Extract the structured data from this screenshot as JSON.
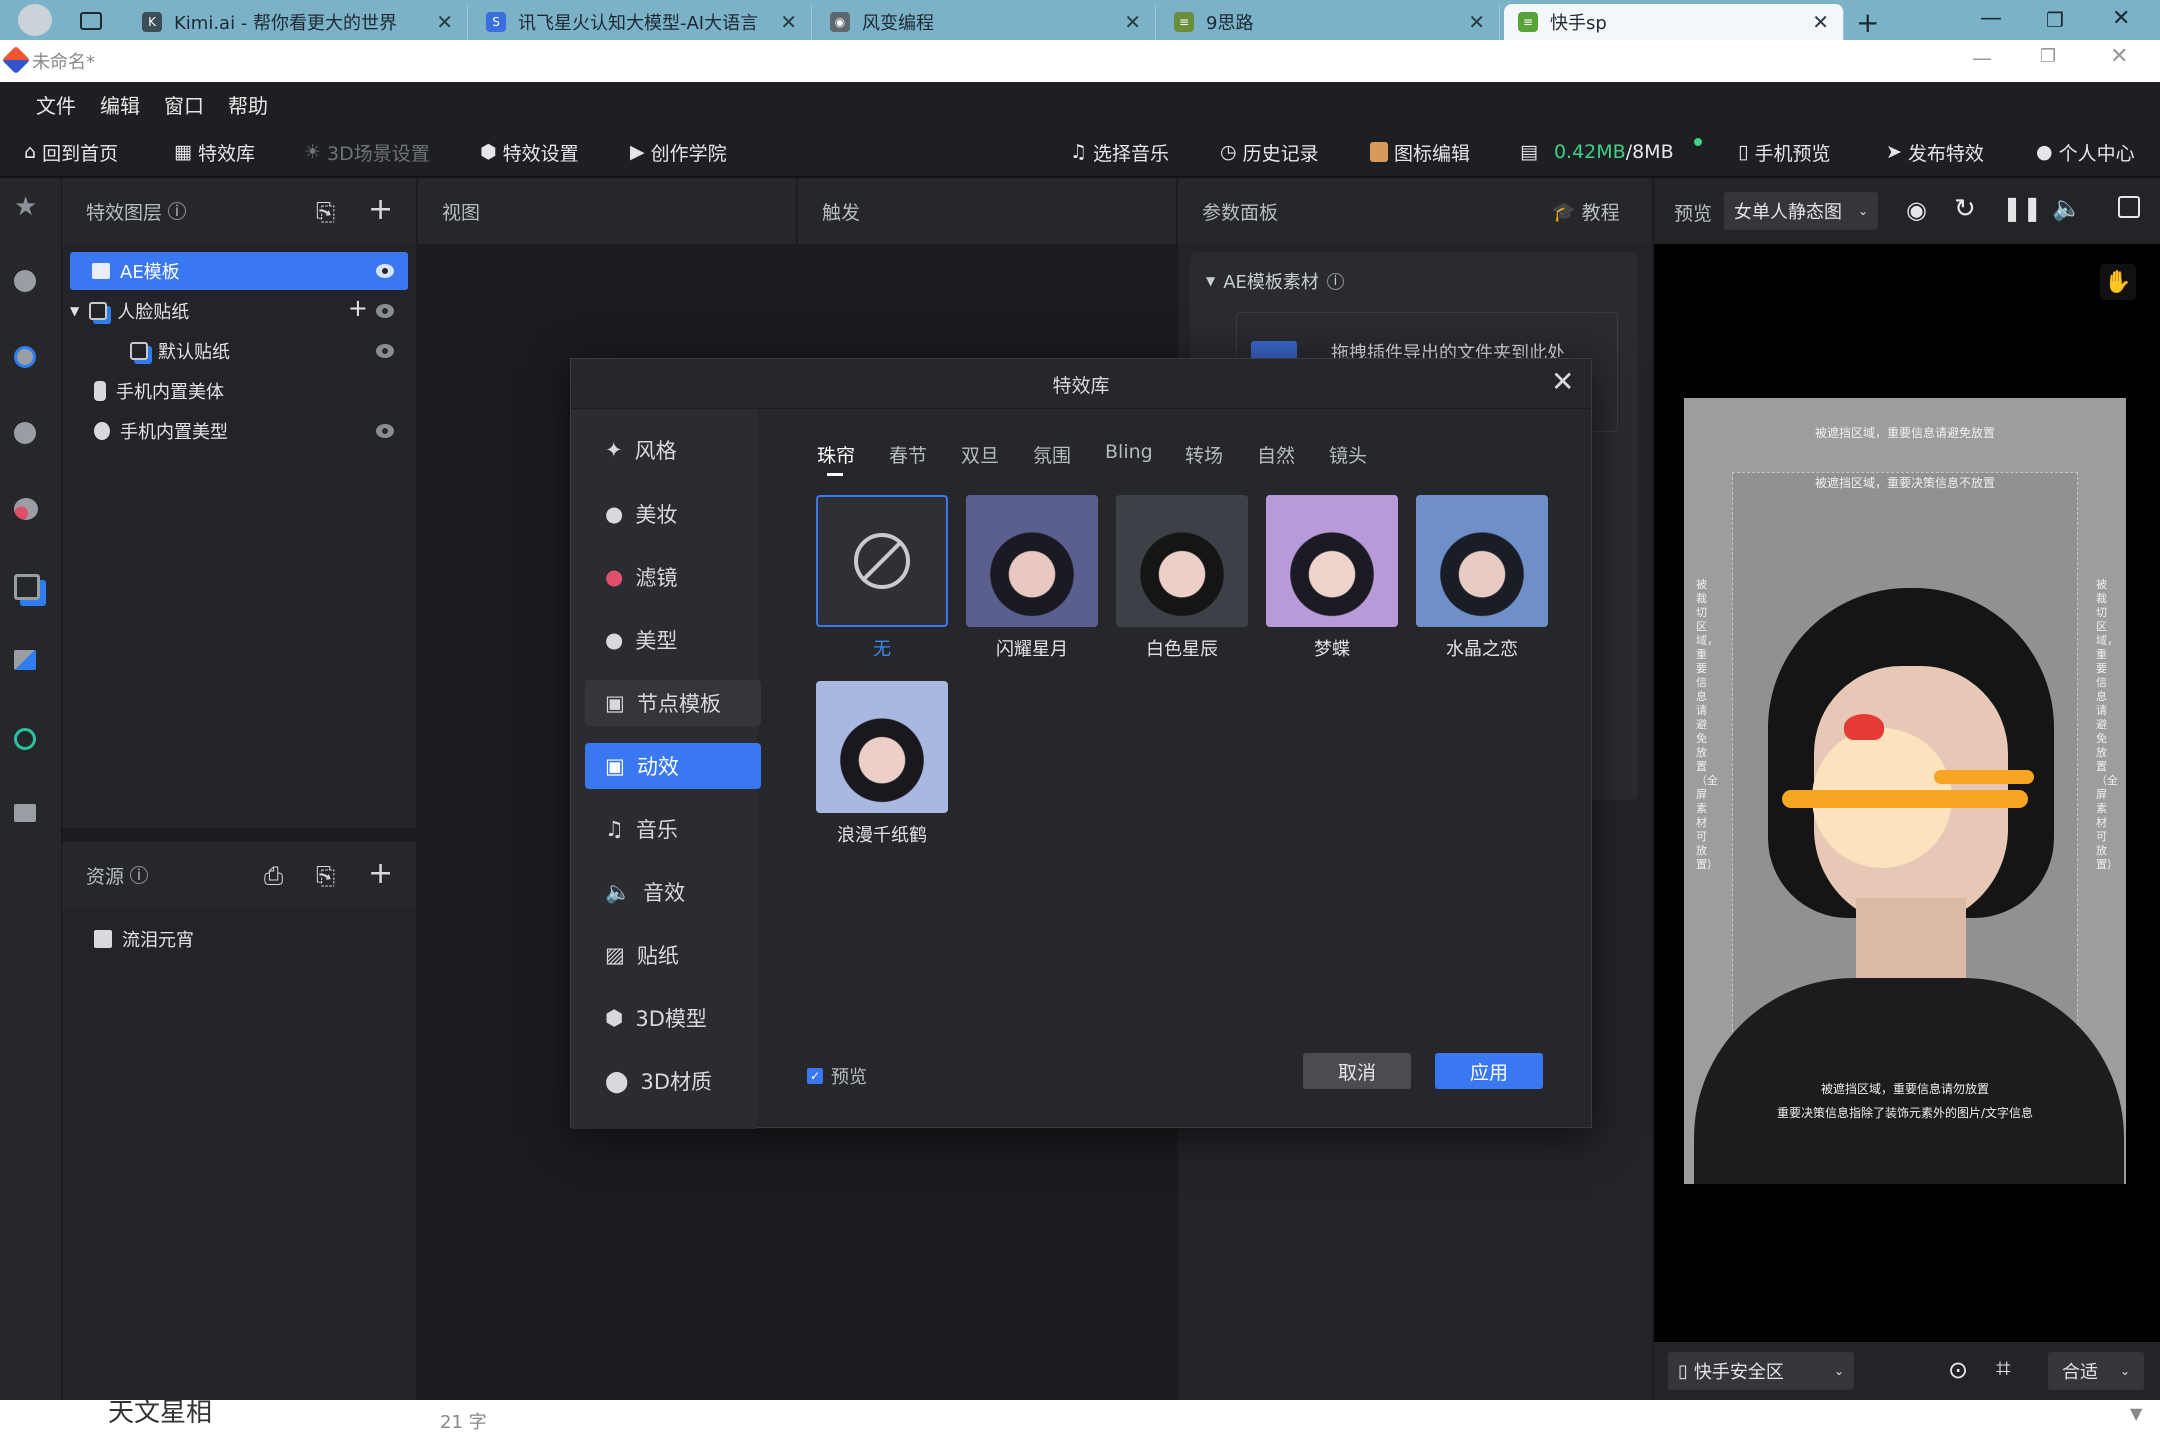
{
  "browser": {
    "tabs": [
      {
        "title": "Kimi.ai - 帮你看更大的世界"
      },
      {
        "title": "讯飞星火认知大模型-AI大语言"
      },
      {
        "title": "风变编程"
      },
      {
        "title": "9思路"
      },
      {
        "title": "快手sp"
      }
    ]
  },
  "window": {
    "title": "未命名*"
  },
  "menu": [
    "文件",
    "编辑",
    "窗口",
    "帮助"
  ],
  "toolbar": {
    "home": "回到首页",
    "library": "特效库",
    "scene3d": "3D场景设置",
    "settings": "特效设置",
    "academy": "创作学院",
    "music": "选择音乐",
    "history": "历史记录",
    "icon_edit": "图标编辑",
    "size_used": "0.42MB",
    "size_total": "/8MB",
    "phone_preview": "手机预览",
    "publish": "发布特效",
    "profile": "个人中心"
  },
  "layers_panel": {
    "title": "特效图层",
    "items": [
      {
        "label": "AE模板"
      },
      {
        "label": "人脸贴纸"
      },
      {
        "label": "默认贴纸"
      },
      {
        "label": "手机内置美体"
      },
      {
        "label": "手机内置美型"
      }
    ]
  },
  "resources_panel": {
    "title": "资源",
    "items": [
      {
        "label": "流泪元宵"
      }
    ]
  },
  "view_panel": {
    "title": "视图"
  },
  "trigger_panel": {
    "title": "触发"
  },
  "params_panel": {
    "title": "参数面板",
    "tutorial": "教程",
    "section": "AE模板素材",
    "hint": "拖拽插件导出的文件夹到此处"
  },
  "preview_panel": {
    "label": "预览",
    "mode": "女单人静态图",
    "safe_area": "快手安全区",
    "fit": "合适",
    "overlay_top1": "被遮挡区域，重要信息请避免放置",
    "overlay_top2": "被遮挡区域，重要决策信息不放置",
    "overlay_side": "被裁切区域，重要信息请避免放置（全屏素材可放置）",
    "overlay_bottom1": "被遮挡区域，重要信息请勿放置",
    "overlay_bottom2": "重要决策信息指除了装饰元素外的图片/文字信息"
  },
  "dialog": {
    "title": "特效库",
    "categories": [
      "风格",
      "美妆",
      "滤镜",
      "美型",
      "节点模板",
      "动效",
      "音乐",
      "音效",
      "贴纸",
      "3D模型",
      "3D材质"
    ],
    "subtabs": [
      "珠帘",
      "春节",
      "双旦",
      "氛围",
      "Bling",
      "转场",
      "自然",
      "镜头"
    ],
    "effects": [
      {
        "label": "无"
      },
      {
        "label": "闪耀星月"
      },
      {
        "label": "白色星辰"
      },
      {
        "label": "梦蝶"
      },
      {
        "label": "水晶之恋"
      },
      {
        "label": "浪漫千纸鹤"
      }
    ],
    "preview_checkbox": "预览",
    "cancel": "取消",
    "apply": "应用"
  },
  "background_doc": {
    "snippet": "天文星相",
    "word_count": "21 字"
  }
}
